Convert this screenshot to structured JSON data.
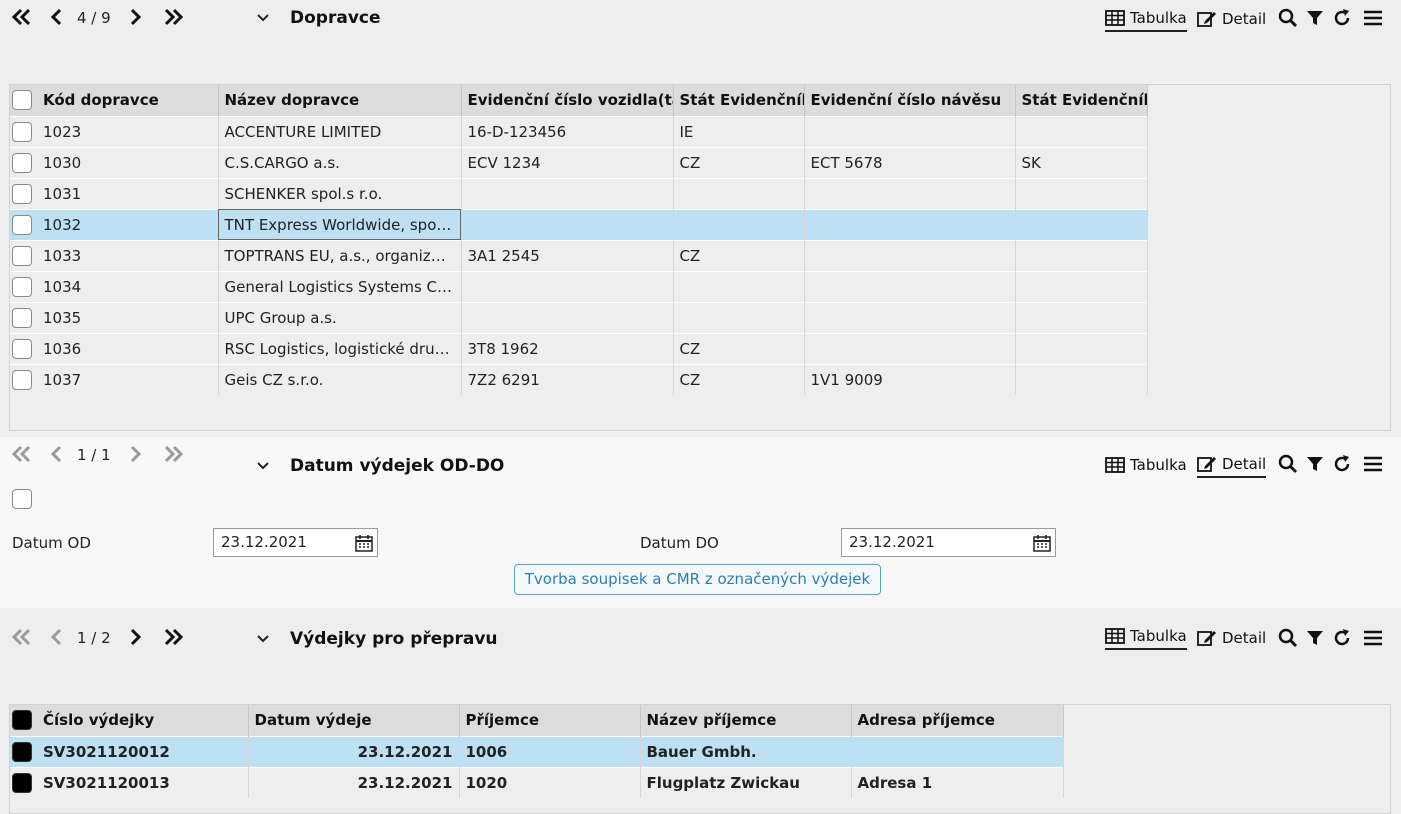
{
  "section1": {
    "pager": "4 / 9",
    "title": "Dopravce",
    "tab_table": "Tabulka",
    "tab_detail": "Detail",
    "columns": [
      "Kód dopravce",
      "Název dopravce",
      "Evidenční číslo vozidla(taha",
      "Stát Evidenčního",
      "Evidenční číslo návěsu",
      "Stát Evidenčního"
    ],
    "rows": [
      [
        "1023",
        "ACCENTURE LIMITED",
        "16-D-123456",
        "IE",
        "",
        ""
      ],
      [
        "1030",
        "C.S.CARGO a.s.",
        "ECV 1234",
        "CZ",
        "ECT 5678",
        "SK"
      ],
      [
        "1031",
        "SCHENKER spol.s r.o.",
        "",
        "",
        "",
        ""
      ],
      [
        "1032",
        "TNT Express Worldwide, spol....",
        "",
        "",
        "",
        ""
      ],
      [
        "1033",
        "TOPTRANS EU, a.s., organizač...",
        "3A1 2545",
        "CZ",
        "",
        ""
      ],
      [
        "1034",
        "General Logistics Systems Cz...",
        "",
        "",
        "",
        ""
      ],
      [
        "1035",
        "UPC Group a.s.",
        "",
        "",
        "",
        ""
      ],
      [
        "1036",
        "RSC Logistics, logistické družs...",
        "3T8 1962",
        "CZ",
        "",
        ""
      ],
      [
        "1037",
        "Geis CZ s.r.o.",
        "7Z2 6291",
        "CZ",
        "1V1 9009",
        ""
      ]
    ],
    "selected_row": "1032"
  },
  "section2": {
    "pager": "1 / 1",
    "title": "Datum výdejek OD-DO",
    "tab_table": "Tabulka",
    "tab_detail": "Detail",
    "date_from_label": "Datum OD",
    "date_from_value": "23.12.2021",
    "date_to_label": "Datum DO",
    "date_to_value": "23.12.2021",
    "action_button": "Tvorba soupisek a CMR z označených výdejek"
  },
  "section3": {
    "pager": "1 / 2",
    "title": "Výdejky pro přepravu",
    "tab_table": "Tabulka",
    "tab_detail": "Detail",
    "columns": [
      "Číslo výdejky",
      "Datum výdeje",
      "Příjemce",
      "Název příjemce",
      "Adresa příjemce"
    ],
    "rows": [
      [
        "SV3021120012",
        "23.12.2021",
        "1006",
        "Bauer Gmbh.",
        ""
      ],
      [
        "SV3021120013",
        "23.12.2021",
        "1020",
        "Flugplatz Zwickau",
        "Adresa 1"
      ]
    ]
  },
  "colors": {
    "selected_row": "#bde0f3",
    "header_bg": "#dcdcdc",
    "button_border": "#5aa2c8",
    "button_text": "#2f7fae"
  }
}
